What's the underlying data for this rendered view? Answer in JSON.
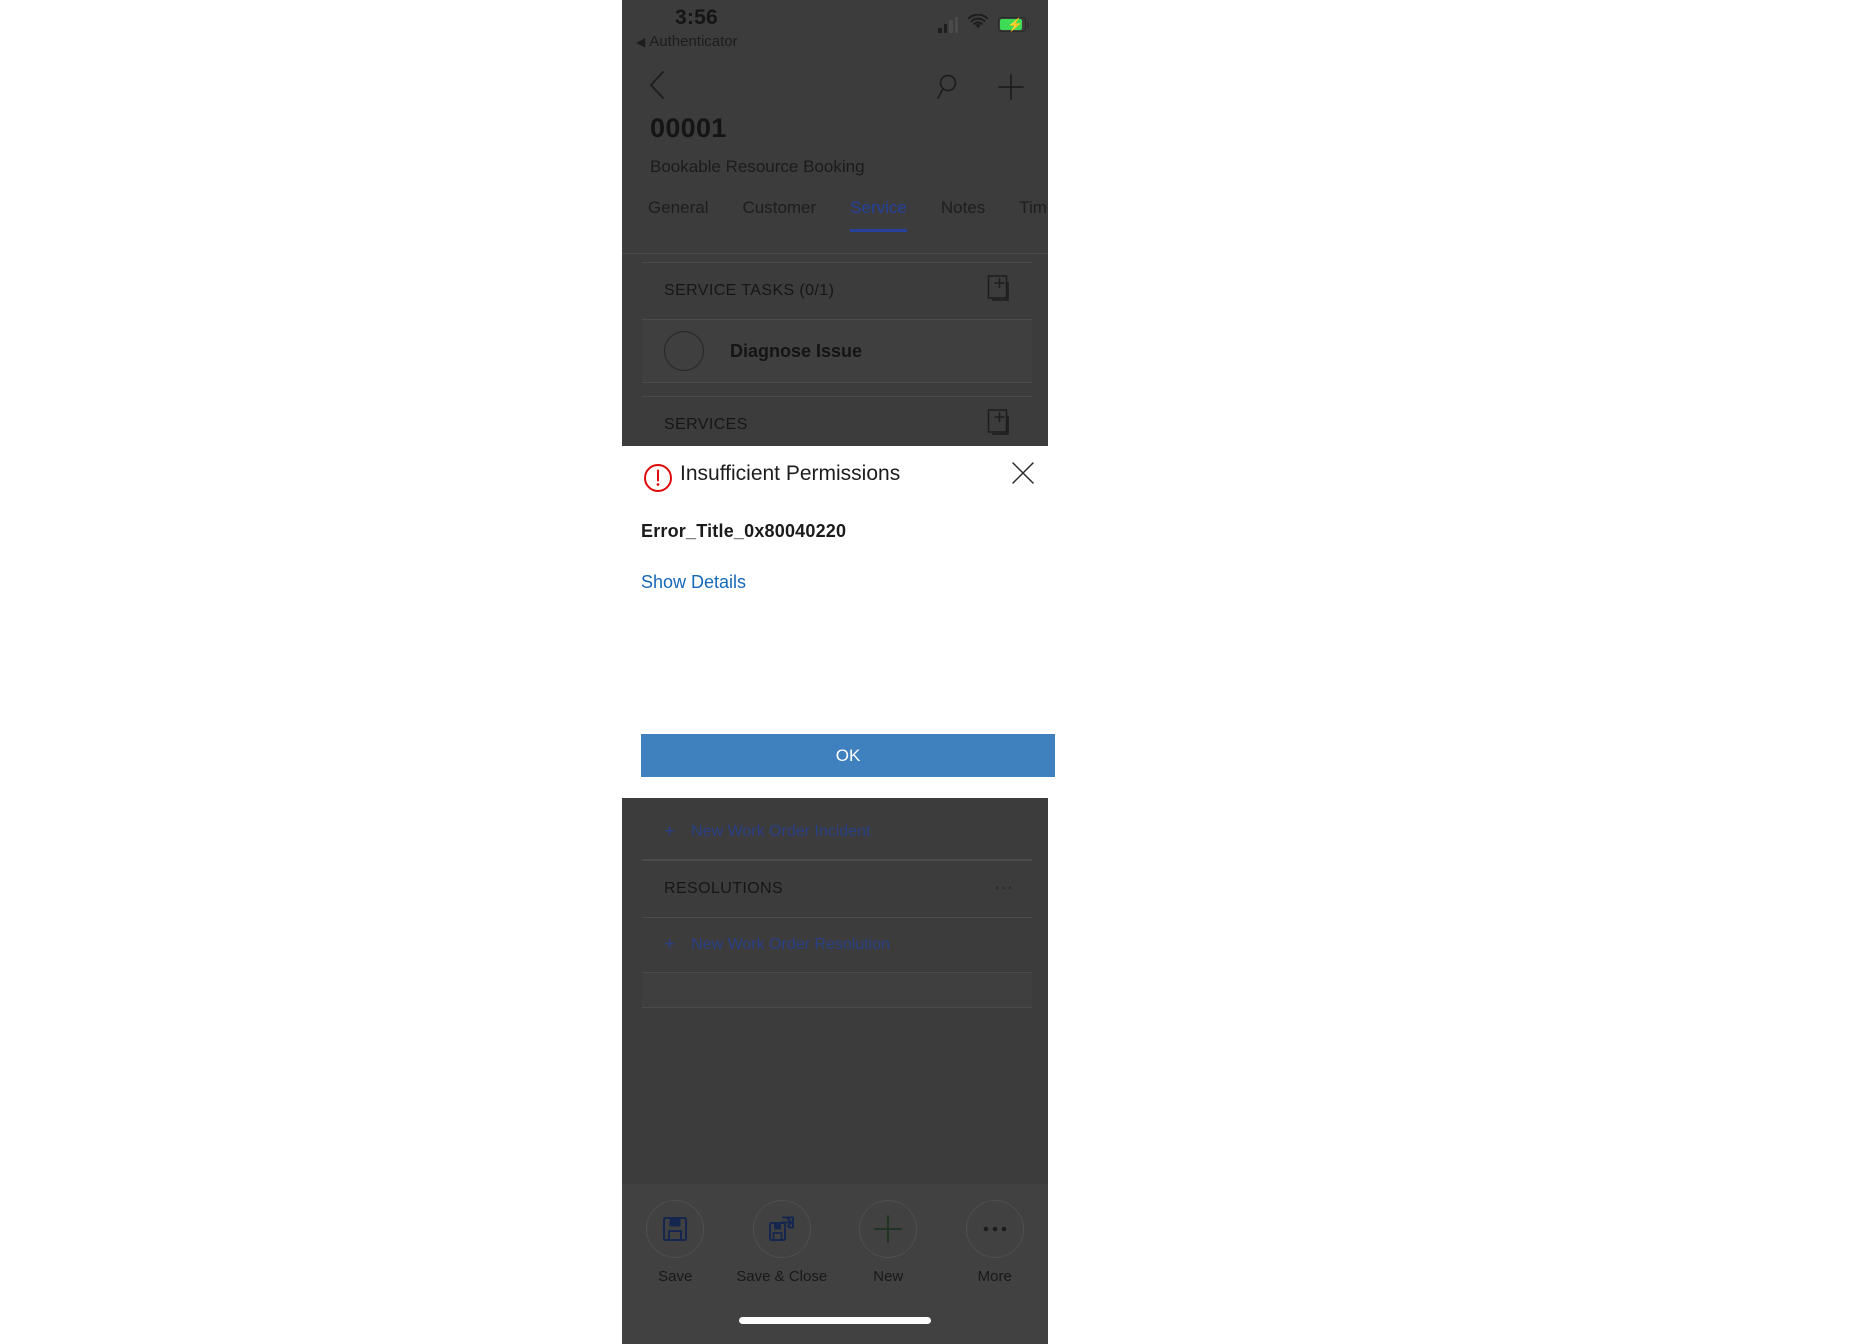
{
  "status_bar": {
    "time": "3:56",
    "back_app_label": "Authenticator",
    "back_triangle": "◀",
    "signal_icon": "cellular-signal-icon",
    "wifi_icon": "wifi-icon",
    "battery_icon": "battery-charging-icon"
  },
  "command_row": {
    "back_icon": "back-chevron-icon",
    "search_icon": "search-icon",
    "add_icon": "plus-icon"
  },
  "record": {
    "title": "00001",
    "subtitle": "Bookable Resource Booking"
  },
  "tabs": [
    {
      "label": "General",
      "active": false
    },
    {
      "label": "Customer",
      "active": false
    },
    {
      "label": "Service",
      "active": true
    },
    {
      "label": "Notes",
      "active": false
    },
    {
      "label": "Timelin",
      "active": false
    }
  ],
  "sections": {
    "service_tasks": {
      "title": "SERVICE TASKS (0/1)",
      "add_icon": "add-record-icon",
      "items": [
        {
          "label": "Diagnose Issue",
          "checkbox_icon": "empty-circle-icon"
        }
      ]
    },
    "services": {
      "title": "SERVICES",
      "add_icon": "add-record-icon"
    },
    "incidents": {
      "new_link": "New Work Order Incident",
      "plus": "+"
    },
    "resolutions": {
      "title": "RESOLUTIONS",
      "overflow_icon": "ellipsis-icon",
      "new_link": "New Work Order Resolution",
      "plus": "+"
    }
  },
  "dialog": {
    "icon": "error-exclamation-icon",
    "title": "Insufficient Permissions",
    "close_icon": "close-icon",
    "error_title": "Error_Title_0x80040220",
    "show_details_link": "Show Details",
    "ok_label": "OK",
    "accent_color": "#3f80bf",
    "error_color": "#e00b0b",
    "link_color": "#1668b8"
  },
  "bottom_bar": {
    "commands": [
      {
        "label": "Save",
        "icon": "save-floppy-icon"
      },
      {
        "label": "Save & Close",
        "icon": "save-and-close-icon"
      },
      {
        "label": "New",
        "icon": "plus-icon"
      },
      {
        "label": "More",
        "icon": "ellipsis-icon"
      }
    ],
    "home_indicator": "home-indicator-bar"
  }
}
